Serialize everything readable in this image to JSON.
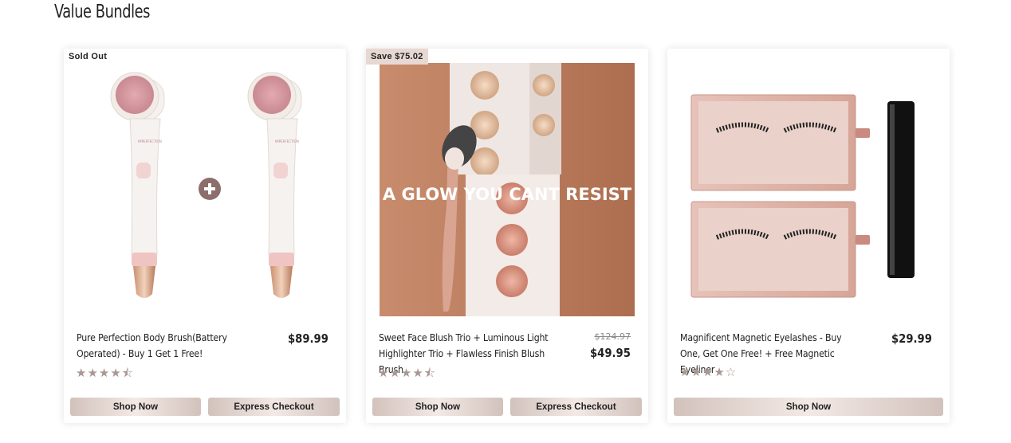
{
  "section": {
    "title": "Value Bundles"
  },
  "colors": {
    "accent": "#a89792",
    "button_gradient": "#e8d8d2",
    "badge_bg": "#e8d8d2"
  },
  "cards": [
    {
      "badge": "Sold Out",
      "title": "Pure Perfection Body Brush(Battery Operated) - Buy 1 Get 1 Free!",
      "price": "$89.99",
      "rating": 4.5,
      "stars": "★★★★⯪",
      "buttons": {
        "shop": "Shop Now",
        "express": "Express Checkout"
      }
    },
    {
      "badge": "Save $75.02",
      "image_text": "A GLOW YOU CANT RESIST",
      "title": "Sweet Face Blush Trio + Luminous Light Highlighter Trio + Flawless Finish Blush Brush",
      "original_price": "$124.97",
      "price": "$49.95",
      "rating": 4.5,
      "stars": "★★★★⯪",
      "buttons": {
        "shop": "Shop Now",
        "express": "Express Checkout"
      }
    },
    {
      "title": "Magnificent Magnetic Eyelashes - Buy One, Get One Free! + Free Magnetic Eyeliner",
      "price": "$29.99",
      "rating": 4,
      "stars": "★★★★☆",
      "buttons": {
        "shop": "Shop Now"
      }
    }
  ]
}
